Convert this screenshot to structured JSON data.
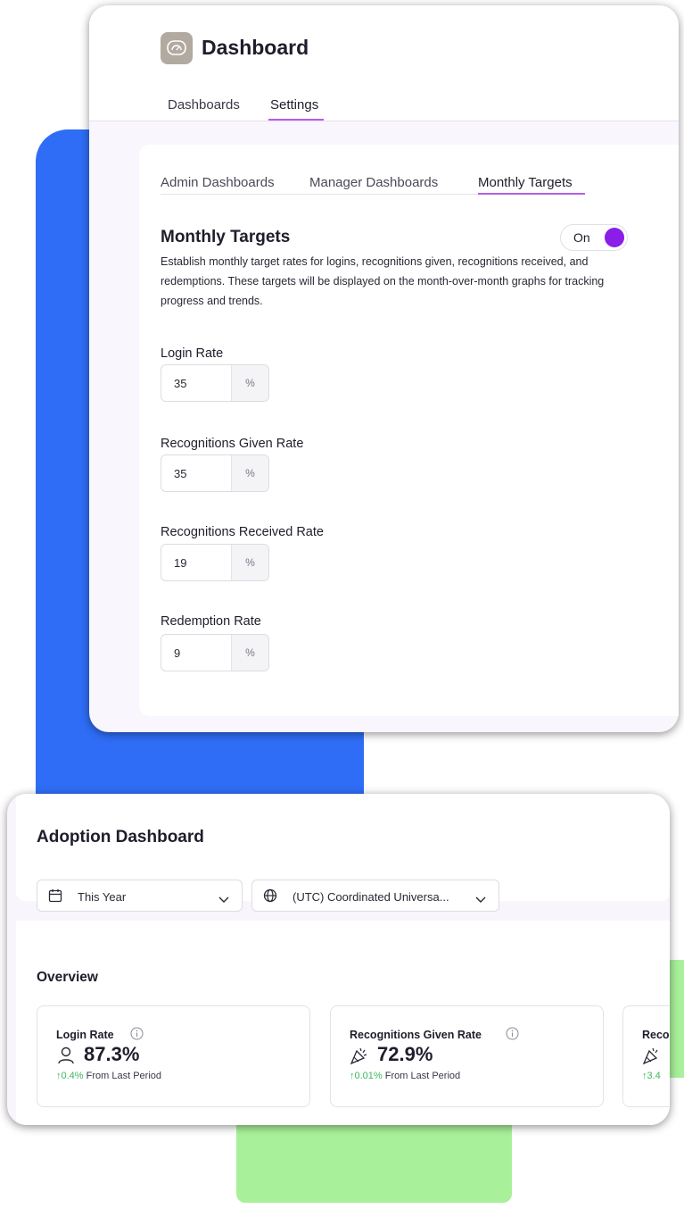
{
  "settings_window": {
    "app_title": "Dashboard",
    "app_icon": "speedometer-icon",
    "top_tabs": [
      "Dashboards",
      "Settings"
    ],
    "active_top_tab": "Settings",
    "sub_tabs": [
      "Admin Dashboards",
      "Manager Dashboards",
      "Monthly Targets"
    ],
    "active_sub_tab": "Monthly Targets",
    "section": {
      "title": "Monthly Targets",
      "toggle_label": "On",
      "toggle_color": "#8a1de8",
      "description": "Establish monthly target rates for logins, recognitions given, recognitions received, and redemptions. These targets will be displayed on the month-over-month graphs for tracking progress and trends."
    },
    "fields": [
      {
        "label": "Login Rate",
        "value": "35",
        "unit": "%"
      },
      {
        "label": "Recognitions Given Rate",
        "value": "35",
        "unit": "%"
      },
      {
        "label": "Recognitions Received Rate",
        "value": "19",
        "unit": "%"
      },
      {
        "label": "Redemption Rate",
        "value": "9",
        "unit": "%"
      }
    ]
  },
  "adoption_window": {
    "title": "Adoption Dashboard",
    "date_filter": {
      "value": "This Year",
      "icon": "calendar-icon"
    },
    "timezone_filter": {
      "value": "(UTC) Coordinated Universa...",
      "icon": "globe-icon"
    },
    "overview_title": "Overview",
    "metrics": [
      {
        "title": "Login Rate",
        "icon": "user-icon",
        "value": "87.3%",
        "delta": "↑0.4%",
        "delta_suffix": "From Last Period"
      },
      {
        "title": "Recognitions Given Rate",
        "icon": "party-popper-icon",
        "value": "72.9%",
        "delta": "↑0.01%",
        "delta_suffix": "From Last Period"
      },
      {
        "title": "Reco",
        "icon": "party-popper-icon",
        "value": "",
        "delta": "↑3.4",
        "delta_suffix": ""
      }
    ]
  },
  "colors": {
    "accent": "#b160e6",
    "toggle": "#8a1de8",
    "backdrop_blue": "#2f6df6",
    "backdrop_green": "#a8f09a",
    "positive": "#3eb85b"
  }
}
